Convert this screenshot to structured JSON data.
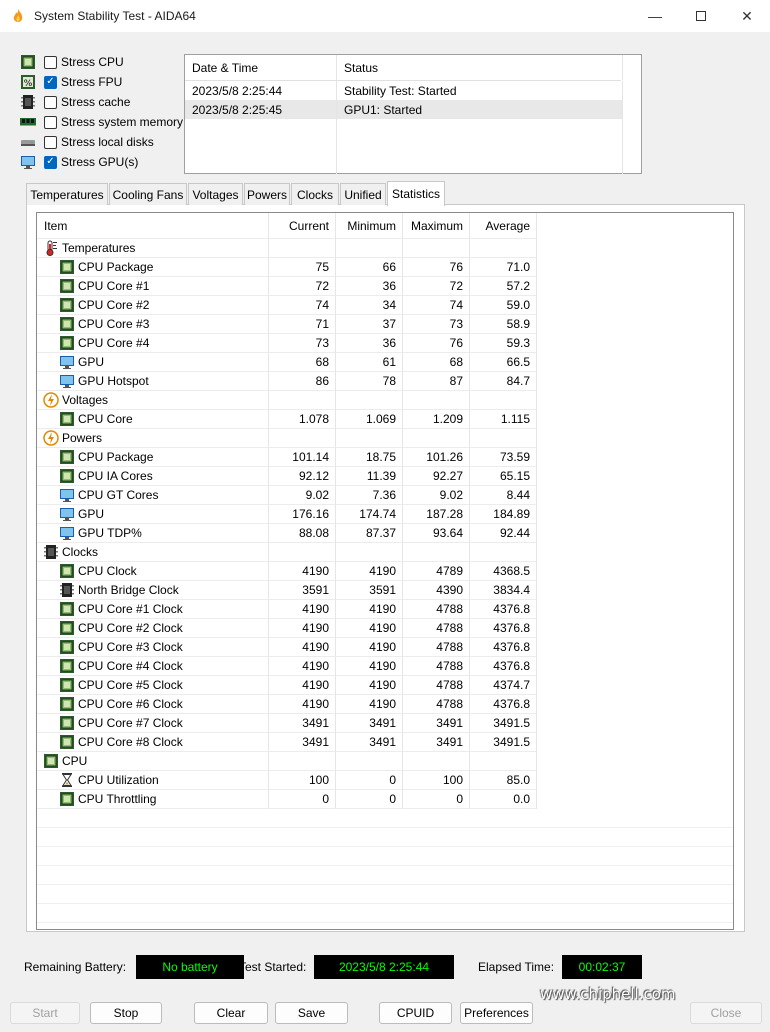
{
  "window": {
    "title": "System Stability Test - AIDA64"
  },
  "options": [
    {
      "label": "Stress CPU",
      "checked": false,
      "icon": "cpu-chip-icon"
    },
    {
      "label": "Stress FPU",
      "checked": true,
      "icon": "fpu-percent-icon"
    },
    {
      "label": "Stress cache",
      "checked": false,
      "icon": "cache-chip-icon"
    },
    {
      "label": "Stress system memory",
      "checked": false,
      "icon": "memory-module-icon"
    },
    {
      "label": "Stress local disks",
      "checked": false,
      "icon": "disk-drive-icon"
    },
    {
      "label": "Stress GPU(s)",
      "checked": true,
      "icon": "gpu-monitor-icon"
    }
  ],
  "log": {
    "headers": [
      "Date & Time",
      "Status"
    ],
    "rows": [
      {
        "time": "2023/5/8 2:25:44",
        "status": "Stability Test: Started"
      },
      {
        "time": "2023/5/8 2:25:45",
        "status": "GPU1: Started"
      }
    ]
  },
  "tabs": [
    "Temperatures",
    "Cooling Fans",
    "Voltages",
    "Powers",
    "Clocks",
    "Unified",
    "Statistics"
  ],
  "active_tab": "Statistics",
  "stats": {
    "headers": [
      "Item",
      "Current",
      "Minimum",
      "Maximum",
      "Average"
    ],
    "rows": [
      {
        "group": true,
        "name": "Temperatures",
        "icon": "thermometer-icon"
      },
      {
        "name": "CPU Package",
        "icon": "cpu-chip-icon",
        "cur": "75",
        "min": "66",
        "max": "76",
        "avg": "71.0"
      },
      {
        "name": "CPU Core #1",
        "icon": "cpu-chip-icon",
        "cur": "72",
        "min": "36",
        "max": "72",
        "avg": "57.2"
      },
      {
        "name": "CPU Core #2",
        "icon": "cpu-chip-icon",
        "cur": "74",
        "min": "34",
        "max": "74",
        "avg": "59.0"
      },
      {
        "name": "CPU Core #3",
        "icon": "cpu-chip-icon",
        "cur": "71",
        "min": "37",
        "max": "73",
        "avg": "58.9"
      },
      {
        "name": "CPU Core #4",
        "icon": "cpu-chip-icon",
        "cur": "73",
        "min": "36",
        "max": "76",
        "avg": "59.3"
      },
      {
        "name": "GPU",
        "icon": "gpu-monitor-icon",
        "cur": "68",
        "min": "61",
        "max": "68",
        "avg": "66.5"
      },
      {
        "name": "GPU Hotspot",
        "icon": "gpu-monitor-icon",
        "cur": "86",
        "min": "78",
        "max": "87",
        "avg": "84.7"
      },
      {
        "group": true,
        "name": "Voltages",
        "icon": "lightning-icon"
      },
      {
        "name": "CPU Core",
        "icon": "cpu-chip-icon",
        "cur": "1.078",
        "min": "1.069",
        "max": "1.209",
        "avg": "1.115"
      },
      {
        "group": true,
        "name": "Powers",
        "icon": "lightning-icon"
      },
      {
        "name": "CPU Package",
        "icon": "cpu-chip-icon",
        "cur": "101.14",
        "min": "18.75",
        "max": "101.26",
        "avg": "73.59"
      },
      {
        "name": "CPU IA Cores",
        "icon": "cpu-chip-icon",
        "cur": "92.12",
        "min": "11.39",
        "max": "92.27",
        "avg": "65.15"
      },
      {
        "name": "CPU GT Cores",
        "icon": "gpu-monitor-icon",
        "cur": "9.02",
        "min": "7.36",
        "max": "9.02",
        "avg": "8.44"
      },
      {
        "name": "GPU",
        "icon": "gpu-monitor-icon",
        "cur": "176.16",
        "min": "174.74",
        "max": "187.28",
        "avg": "184.89"
      },
      {
        "name": "GPU TDP%",
        "icon": "gpu-monitor-icon",
        "cur": "88.08",
        "min": "87.37",
        "max": "93.64",
        "avg": "92.44"
      },
      {
        "group": true,
        "name": "Clocks",
        "icon": "clock-chip-icon"
      },
      {
        "name": "CPU Clock",
        "icon": "cpu-chip-icon",
        "cur": "4190",
        "min": "4190",
        "max": "4789",
        "avg": "4368.5"
      },
      {
        "name": "North Bridge Clock",
        "icon": "clock-chip-icon",
        "cur": "3591",
        "min": "3591",
        "max": "4390",
        "avg": "3834.4"
      },
      {
        "name": "CPU Core #1 Clock",
        "icon": "cpu-chip-icon",
        "cur": "4190",
        "min": "4190",
        "max": "4788",
        "avg": "4376.8"
      },
      {
        "name": "CPU Core #2 Clock",
        "icon": "cpu-chip-icon",
        "cur": "4190",
        "min": "4190",
        "max": "4788",
        "avg": "4376.8"
      },
      {
        "name": "CPU Core #3 Clock",
        "icon": "cpu-chip-icon",
        "cur": "4190",
        "min": "4190",
        "max": "4788",
        "avg": "4376.8"
      },
      {
        "name": "CPU Core #4 Clock",
        "icon": "cpu-chip-icon",
        "cur": "4190",
        "min": "4190",
        "max": "4788",
        "avg": "4376.8"
      },
      {
        "name": "CPU Core #5 Clock",
        "icon": "cpu-chip-icon",
        "cur": "4190",
        "min": "4190",
        "max": "4788",
        "avg": "4374.7"
      },
      {
        "name": "CPU Core #6 Clock",
        "icon": "cpu-chip-icon",
        "cur": "4190",
        "min": "4190",
        "max": "4788",
        "avg": "4376.8"
      },
      {
        "name": "CPU Core #7 Clock",
        "icon": "cpu-chip-icon",
        "cur": "3491",
        "min": "3491",
        "max": "3491",
        "avg": "3491.5"
      },
      {
        "name": "CPU Core #8 Clock",
        "icon": "cpu-chip-icon",
        "cur": "3491",
        "min": "3491",
        "max": "3491",
        "avg": "3491.5"
      },
      {
        "group": true,
        "name": "CPU",
        "icon": "cpu-chip-icon"
      },
      {
        "name": "CPU Utilization",
        "icon": "hourglass-icon",
        "cur": "100",
        "min": "0",
        "max": "100",
        "avg": "85.0"
      },
      {
        "name": "CPU Throttling",
        "icon": "cpu-chip-icon",
        "cur": "0",
        "min": "0",
        "max": "0",
        "avg": "0.0"
      }
    ]
  },
  "statusbar": {
    "battery_label": "Remaining Battery:",
    "battery_value": "No battery",
    "started_label": "Test Started:",
    "started_value": "2023/5/8 2:25:44",
    "elapsed_label": "Elapsed Time:",
    "elapsed_value": "00:02:37"
  },
  "buttons": {
    "start": "Start",
    "stop": "Stop",
    "clear": "Clear",
    "save": "Save",
    "cpuid": "CPUID",
    "preferences": "Preferences",
    "close": "Close"
  },
  "watermark": "www.chiphell.com",
  "colors": {
    "led_bg": "#000000",
    "led_text": "#00ff00",
    "accent": "#0067c0"
  }
}
